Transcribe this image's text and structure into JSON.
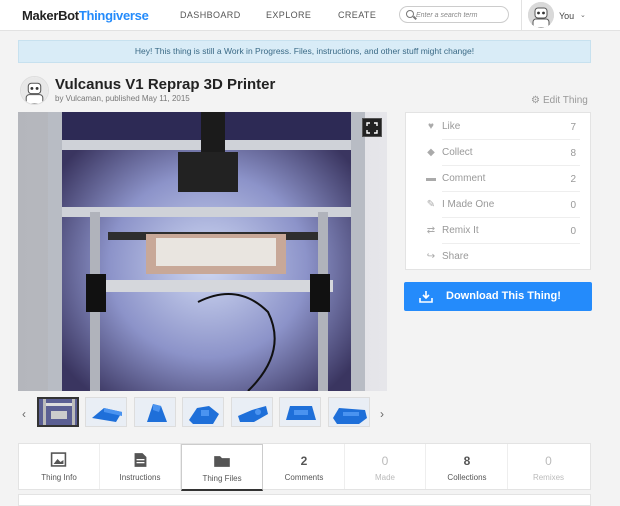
{
  "header": {
    "logo_part1": "MakerBot",
    "logo_part2": "Thingiverse",
    "nav": [
      "DASHBOARD",
      "EXPLORE",
      "CREATE"
    ],
    "search_placeholder": "Enter a search term",
    "user_label": "You",
    "caret": "⌄"
  },
  "banner": "Hey! This thing is still a Work in Progress. Files, instructions, and other stuff might change!",
  "thing": {
    "title": "Vulcanus V1 Reprap 3D Printer",
    "byline": "by Vulcaman, published May 11, 2015",
    "edit_label": "Edit Thing"
  },
  "actions": [
    {
      "label": "Like",
      "count": "7",
      "icon": "heart-icon"
    },
    {
      "label": "Collect",
      "count": "8",
      "icon": "tag-icon"
    },
    {
      "label": "Comment",
      "count": "2",
      "icon": "comment-icon"
    },
    {
      "label": "I Made One",
      "count": "0",
      "icon": "pencil-square-icon"
    },
    {
      "label": "Remix It",
      "count": "0",
      "icon": "shuffle-icon"
    },
    {
      "label": "Share",
      "count": "",
      "icon": "share-icon"
    }
  ],
  "download_label": "Download This Thing!",
  "tabs": [
    {
      "label": "Thing Info",
      "number": "",
      "icon": "image-icon"
    },
    {
      "label": "Instructions",
      "number": "",
      "icon": "document-icon"
    },
    {
      "label": "Thing Files",
      "number": "",
      "icon": "folder-icon"
    },
    {
      "label": "Comments",
      "number": "2"
    },
    {
      "label": "Made",
      "number": "0"
    },
    {
      "label": "Collections",
      "number": "8"
    },
    {
      "label": "Remixes",
      "number": "0"
    }
  ],
  "colors": {
    "accent": "#248bfb",
    "banner_bg": "#d9ecf7"
  },
  "gallery": {
    "prev": "‹",
    "next": "›"
  }
}
